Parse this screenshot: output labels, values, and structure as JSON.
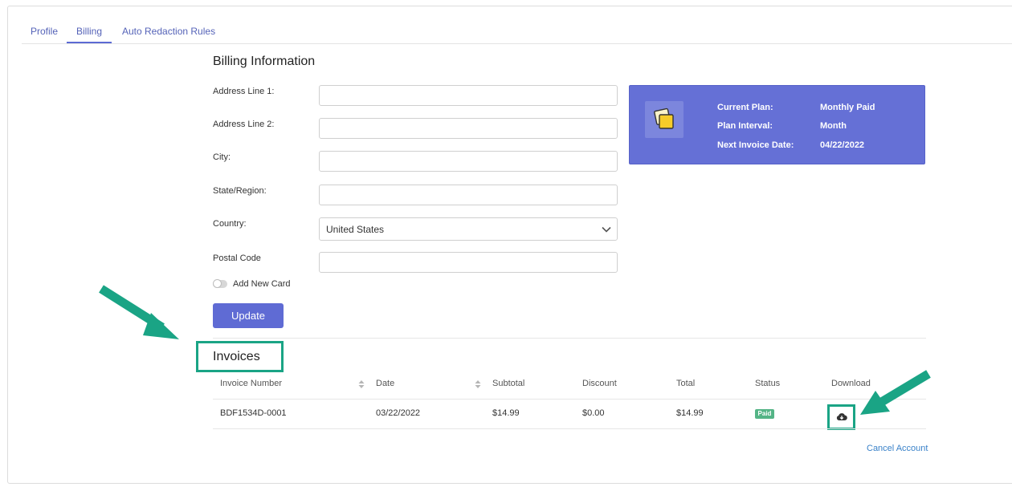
{
  "tabs": [
    {
      "label": "Profile"
    },
    {
      "label": "Billing"
    },
    {
      "label": "Auto Redaction Rules"
    }
  ],
  "billing": {
    "title": "Billing Information",
    "fields": [
      {
        "label": "Address Line 1:",
        "value": ""
      },
      {
        "label": "Address Line 2:",
        "value": ""
      },
      {
        "label": "City:",
        "value": ""
      },
      {
        "label": "State/Region:",
        "value": ""
      },
      {
        "label": "Country:",
        "value": "United States"
      },
      {
        "label": "Postal Code",
        "value": ""
      }
    ],
    "toggle_label": "Add New Card",
    "update_label": "Update"
  },
  "plan": {
    "current_plan_label": "Current Plan:",
    "current_plan_value": "Monthly Paid",
    "interval_label": "Plan Interval:",
    "interval_value": "Month",
    "next_invoice_label": "Next Invoice Date:",
    "next_invoice_value": "04/22/2022"
  },
  "invoices": {
    "title": "Invoices",
    "headers": [
      "Invoice Number",
      "Date",
      "Subtotal",
      "Discount",
      "Total",
      "Status",
      "Download"
    ],
    "rows": [
      {
        "number": "BDF1534D-0001",
        "date": "03/22/2022",
        "subtotal": "$14.99",
        "discount": "$0.00",
        "total": "$14.99",
        "status": "Paid"
      }
    ]
  },
  "cancel_label": "Cancel Account",
  "colors": {
    "accent": "#5f6bd4",
    "highlight": "#1aa485",
    "paid": "#54b486"
  },
  "icons": [
    "chevron-down-icon",
    "sticky-notes-icon",
    "sort-icon",
    "cloud-download-icon",
    "arrow-pointer-icon"
  ]
}
